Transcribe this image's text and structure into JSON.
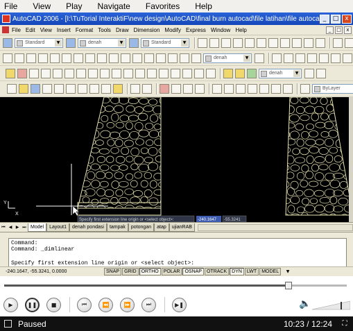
{
  "player": {
    "menu": [
      "File",
      "View",
      "Play",
      "Navigate",
      "Favorites",
      "Help"
    ],
    "status": "Paused",
    "time": "10:23 / 12:24",
    "progress_fraction": 0.83
  },
  "acad": {
    "title": "AutoCAD 2006 - [I:\\TuTorial InteraktiF\\new design\\AutoCAD\\final burn autocad\\file latihan\\file autocad gambar...",
    "title_buttons": [
      "_",
      "□",
      "x"
    ],
    "menu": [
      "File",
      "Edit",
      "View",
      "Insert",
      "Format",
      "Tools",
      "Draw",
      "Dimension",
      "Modify",
      "Express",
      "Window",
      "Help"
    ],
    "toolbar_styles": {
      "text_style": "Standard",
      "dim_style": "denah",
      "table_style": "Standard",
      "layer_combo": "denah",
      "bylayer": "ByLayer"
    },
    "tooltip": "Specify first extension line origin or <select object>:",
    "dyn_x": "-240.1647",
    "dyn_y": "-55.3241",
    "layout_tabs": [
      "Model",
      "Layout1",
      "denah pondasi",
      "tampak",
      "potongan",
      "atap",
      "ujianRAB"
    ],
    "command_lines": [
      "Command:",
      "Command: _dimlinear"
    ],
    "prompt": "Specify first extension line origin or <select object>:",
    "coords": "-240.1647, -55.3241, 0.0000",
    "status_toggles": [
      "SNAP",
      "GRID",
      "ORTHO",
      "POLAR",
      "OSNAP",
      "OTRACK",
      "DYN",
      "LWT",
      "MODEL"
    ],
    "ucs_y": "Y",
    "ucs_x": "X"
  },
  "colors": {
    "drawing_bg": "#000000",
    "stone_lines": "#e8e4b0",
    "title_bar": "#1d55c8",
    "dyn_box": "#3d5bb0"
  },
  "icons": {
    "play": "play-icon",
    "pause": "pause-icon",
    "stop": "stop-icon",
    "prev": "skip-previous-icon",
    "rewind": "rewind-icon",
    "fast_forward": "fast-forward-icon",
    "next": "skip-next-icon",
    "step": "step-frame-icon",
    "volume": "speaker-icon"
  }
}
